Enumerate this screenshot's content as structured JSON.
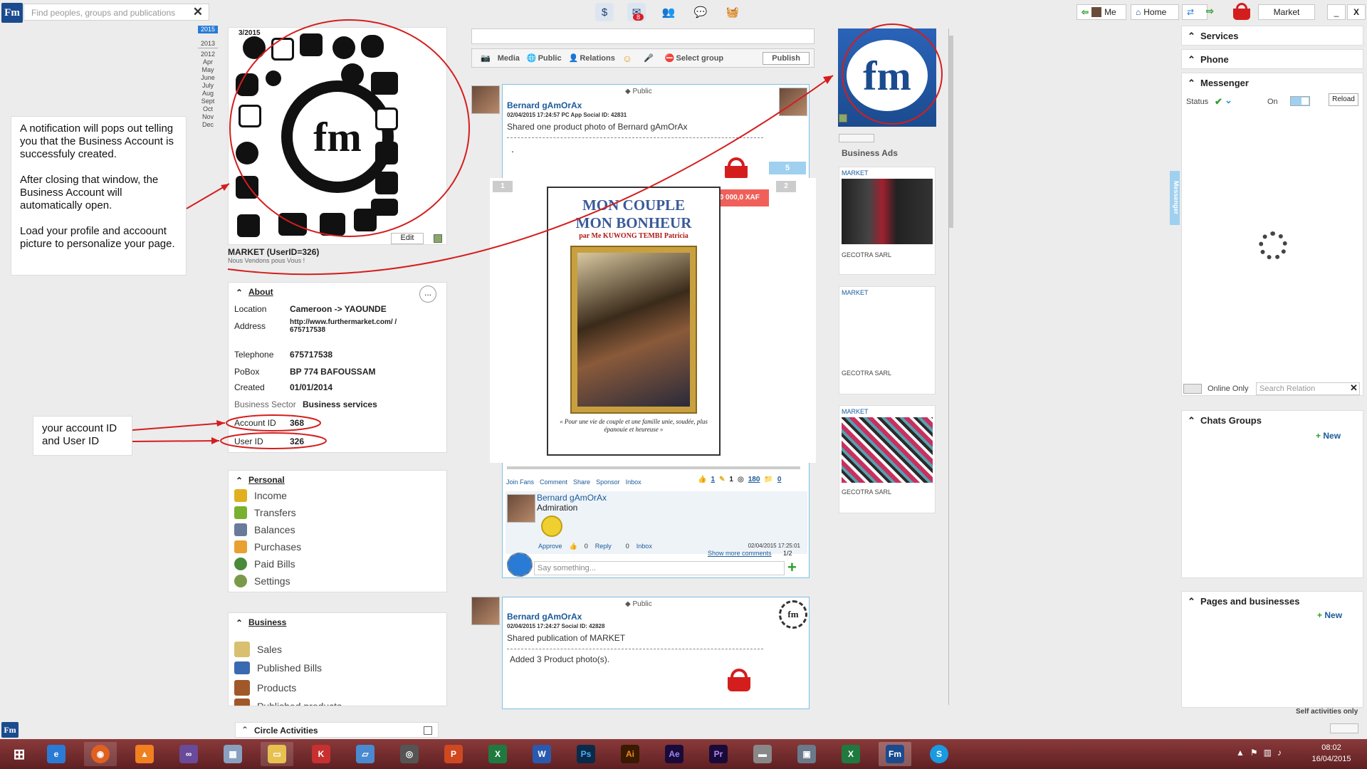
{
  "topbar": {
    "search_placeholder": "Find peoples, groups and publications",
    "notif_count": "8",
    "me_label": "Me",
    "home_label": "Home",
    "market_label": "Market"
  },
  "timeline": {
    "years": [
      "2015",
      "2013",
      "2012"
    ],
    "months": [
      "Apr",
      "May",
      "June",
      "July",
      "Aug",
      "Sept",
      "Oct",
      "Nov",
      "Dec"
    ]
  },
  "profile": {
    "date": "3/2015",
    "name": "MARKET (UserID=326)",
    "slogan": "Nous Vendons pous Vous !",
    "edit_label": "Edit"
  },
  "notes": {
    "note1_p1": "A notification will pops out telling you that the Business Account is successfuly created.",
    "note1_p2": "After closing that window, the Business Account will automatically open.",
    "note1_p3": "Load your profile and accoount picture  to personalize  your page.",
    "note2": "your account ID and User ID"
  },
  "about": {
    "title": "About",
    "more": "...",
    "rows": [
      {
        "label": "Location",
        "value": "Cameroon -> YAOUNDE"
      },
      {
        "label": "Address",
        "value": "http://www.furthermarket.com/ / 675717538"
      },
      {
        "label": "Telephone",
        "value": "675717538"
      },
      {
        "label": "PoBox",
        "value": "BP 774 BAFOUSSAM"
      },
      {
        "label": "Created",
        "value": "01/01/2014"
      },
      {
        "label": "Business Sector",
        "value": "Business services"
      },
      {
        "label": "Account ID",
        "value": "368"
      },
      {
        "label": "User ID",
        "value": "326"
      }
    ]
  },
  "personal": {
    "title": "Personal",
    "items": [
      "Income",
      "Transfers",
      "Balances",
      "Purchases",
      "Paid Bills",
      "Settings"
    ]
  },
  "business": {
    "title": "Business",
    "items": [
      "Sales",
      "Published Bills",
      "Products",
      "Published products"
    ]
  },
  "circle": {
    "title": "Circle Activities"
  },
  "composer": {
    "media": "Media",
    "public": "Public",
    "relations": "Relations",
    "select_group": "Select group",
    "publish": "Publish"
  },
  "post1": {
    "visibility": "Public",
    "author": "Bernard gAmOrAx",
    "meta": "02/04/2015 17:24:57  PC App  Social ID: 42831",
    "text": "Shared one product photo of  Bernard gAmOrAx",
    "dot": ".",
    "photo_count": "5",
    "nav_left": "1",
    "nav_right": "2",
    "price": "10 000,0 XAF",
    "book_title1": "MON COUPLE",
    "book_title2": "MON BONHEUR",
    "book_author": "par Me KUWONG TEMBI Patricia",
    "book_quote": "« Pour une vie de couple et une famille unie, soudée, plus épanouie et heureuse »",
    "actions": [
      "Join Fans",
      "Comment",
      "Share",
      "Sponsor",
      "Inbox"
    ],
    "counts": [
      "1",
      "1",
      "180",
      "0"
    ],
    "comment_author": "Bernard gAmOrAx",
    "comment_text": "Admiration",
    "comment_actions": {
      "approve": "Approve",
      "approve_count": "0",
      "reply": "Reply",
      "reply_count": "0",
      "inbox": "Inbox"
    },
    "comment_time": "02/04/2015 17:25:01",
    "show_more": "Show more comments",
    "pages": "1/2",
    "say_placeholder": "Say something..."
  },
  "post2": {
    "visibility": "Public",
    "author": "Bernard gAmOrAx",
    "meta": "02/04/2015 17:24:27   Social ID: 42828",
    "text": "Shared publication of  MARKET",
    "text2": "Added 3 Product photo(s)."
  },
  "ads": {
    "title": "Business Ads",
    "items": [
      {
        "tag": "MARKET",
        "seller": "GECOTRA SARL"
      },
      {
        "tag": "MARKET",
        "seller": "GECOTRA SARL"
      },
      {
        "tag": "MARKET",
        "seller": "GECOTRA SARL"
      }
    ]
  },
  "right": {
    "services": "Services",
    "phone": "Phone",
    "messenger": "Messenger",
    "status": "Status",
    "on": "On",
    "reload": "Reload",
    "vertical_tab": "Messenger",
    "online_only": "Online Only",
    "search_relation": "Search Relation",
    "chats_groups": "Chats Groups",
    "new1": "New",
    "pages_businesses": "Pages and businesses",
    "new2": "New",
    "self_only": "Self activities only"
  },
  "taskbar": {
    "time": "08:02",
    "date": "16/04/2015"
  },
  "colors": {
    "accent": "#1b4b8f",
    "red": "#d41e1e",
    "post_border": "#7cc0e6"
  }
}
